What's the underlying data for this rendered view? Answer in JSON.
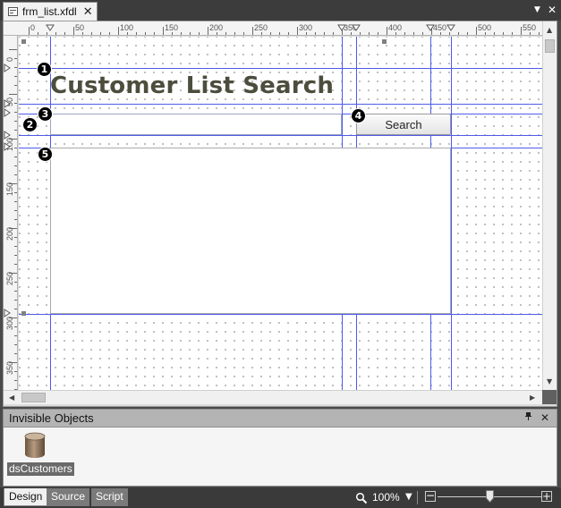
{
  "document_tab": {
    "filename": "frm_list.xfdl",
    "close_glyph": "✕"
  },
  "window_controls": {
    "dropdown_glyph": "▼",
    "close_glyph": "✕"
  },
  "rulers": {
    "horizontal_labels": [
      "0",
      "50",
      "100",
      "150",
      "200",
      "250",
      "300",
      "350",
      "400",
      "450",
      "500",
      "550"
    ],
    "vertical_labels": [
      "0",
      "50",
      "100",
      "150",
      "200",
      "250",
      "300",
      "350"
    ]
  },
  "form": {
    "title_text": "Customer List Search",
    "search_input_value": "",
    "search_button_label": "Search",
    "markers": [
      "1",
      "2",
      "3",
      "4",
      "5"
    ]
  },
  "invisible_objects": {
    "header": "Invisible Objects",
    "pin_glyph": "ᵖ",
    "close_glyph": "✕",
    "items": [
      {
        "name": "dsCustomers",
        "icon": "database-icon"
      }
    ]
  },
  "view_tabs": {
    "design": "Design",
    "source": "Source",
    "script": "Script"
  },
  "zoom": {
    "level": "100%",
    "fraction": 0.5,
    "out_glyph": "−",
    "in_glyph": "+"
  },
  "colors": {
    "guide": "#4d5be8",
    "title": "#4d4d3d",
    "chrome": "#3a3a3a"
  }
}
